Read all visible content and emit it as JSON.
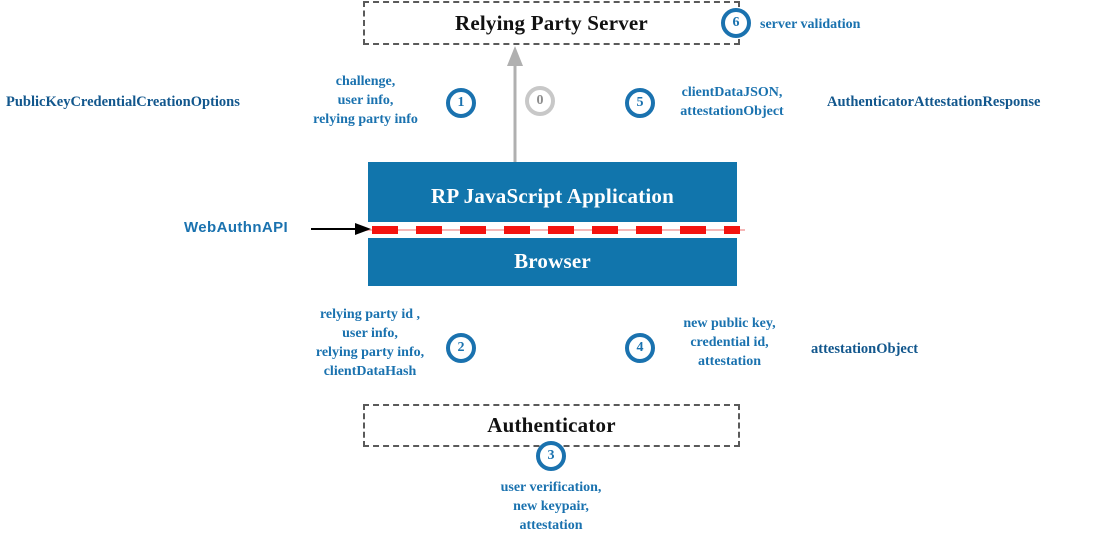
{
  "diagram": {
    "title": "WebAuthn registration ceremony flow",
    "colors": {
      "brand_blue": "#1175ac",
      "accent_blue": "#1a72af",
      "dashed_red": "#f41410",
      "gray_arrow": "#b0b0b0",
      "box_border": "#5a5a5a"
    }
  },
  "nodes": {
    "rp_server": "Relying Party Server",
    "rp_js_app": "RP JavaScript Application",
    "browser": "Browser",
    "authenticator": "Authenticator"
  },
  "api_boundary": {
    "label": "WebAuthnAPI"
  },
  "steps": [
    {
      "number": "0",
      "style": "gray"
    },
    {
      "number": "1",
      "style": "blue"
    },
    {
      "number": "2",
      "style": "blue"
    },
    {
      "number": "3",
      "style": "blue"
    },
    {
      "number": "4",
      "style": "blue"
    },
    {
      "number": "5",
      "style": "blue"
    },
    {
      "number": "6",
      "style": "blue"
    }
  ],
  "annotations": {
    "public_key_credential_creation_options": "PublicKeyCredentialCreationOptions",
    "step1_payload": "challenge,\nuser info,\nrelying party info",
    "step5_payload": "clientDataJSON,\nattestationObject",
    "authenticator_attestation_response": "AuthenticatorAttestationResponse",
    "server_validation": "server validation",
    "step2_payload": "relying party id ,\nuser info,\nrelying party info,\nclientDataHash",
    "step4_payload": "new public key,\ncredential id,\nattestation",
    "attestation_object": "attestationObject",
    "step3_payload": "user verification,\nnew keypair,\nattestation"
  }
}
